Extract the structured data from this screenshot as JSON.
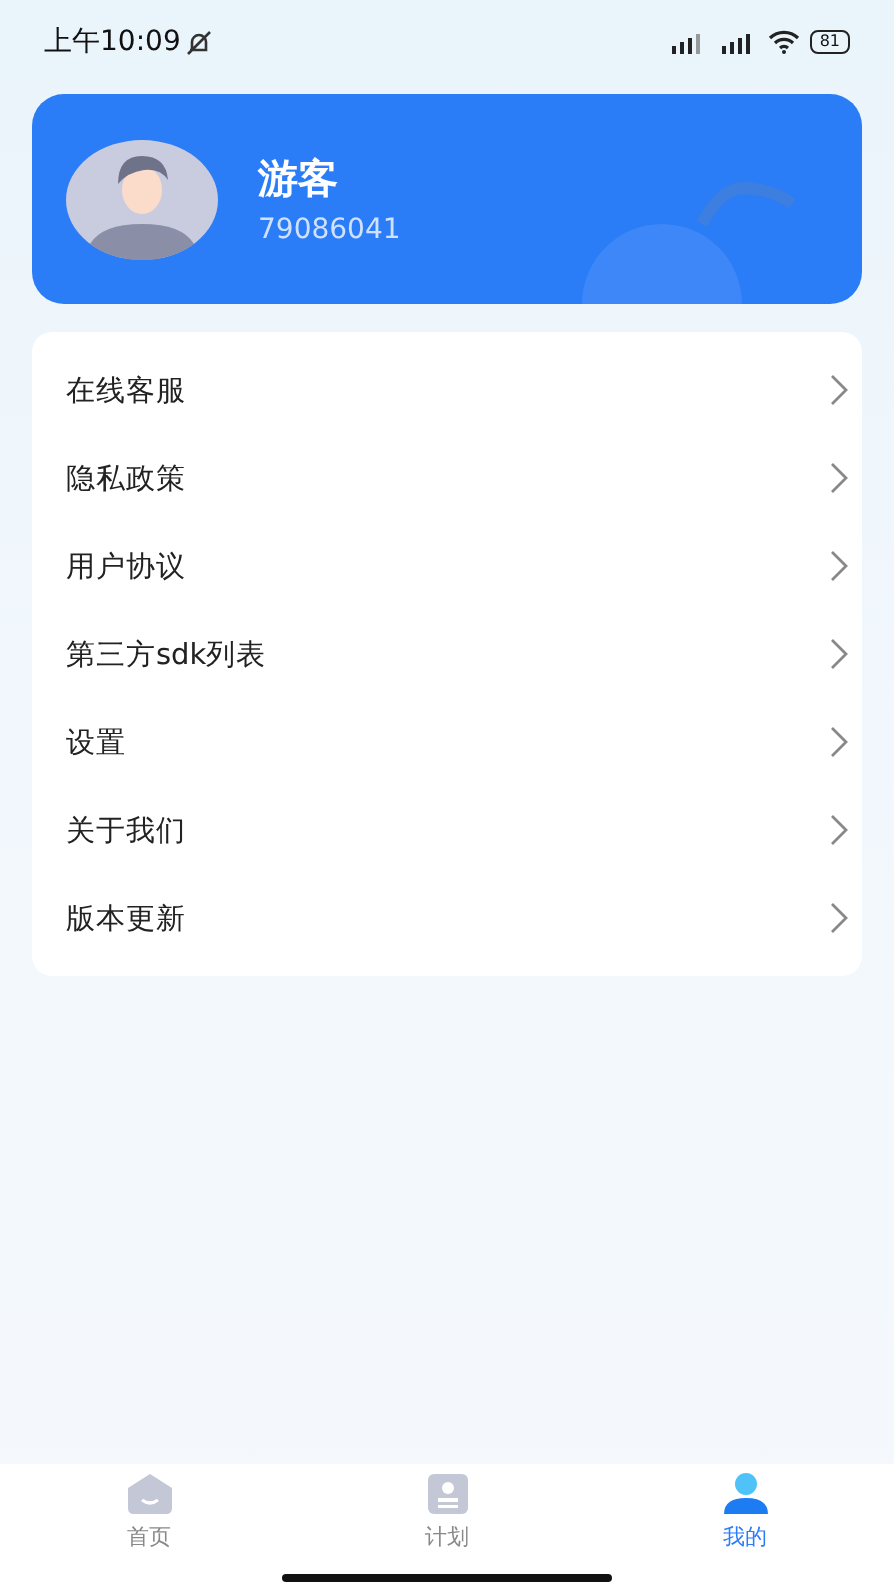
{
  "status_bar": {
    "time": "上午10:09",
    "battery": "81"
  },
  "profile": {
    "name": "游客",
    "id": "79086041"
  },
  "menu": [
    {
      "label": "在线客服"
    },
    {
      "label": "隐私政策"
    },
    {
      "label": "用户协议"
    },
    {
      "label": "第三方sdk列表"
    },
    {
      "label": "设置"
    },
    {
      "label": "关于我们"
    },
    {
      "label": "版本更新"
    }
  ],
  "tabs": [
    {
      "label": "首页",
      "kind": "home",
      "selected": false
    },
    {
      "label": "计划",
      "kind": "plan",
      "selected": false
    },
    {
      "label": "我的",
      "kind": "me",
      "selected": true
    }
  ]
}
